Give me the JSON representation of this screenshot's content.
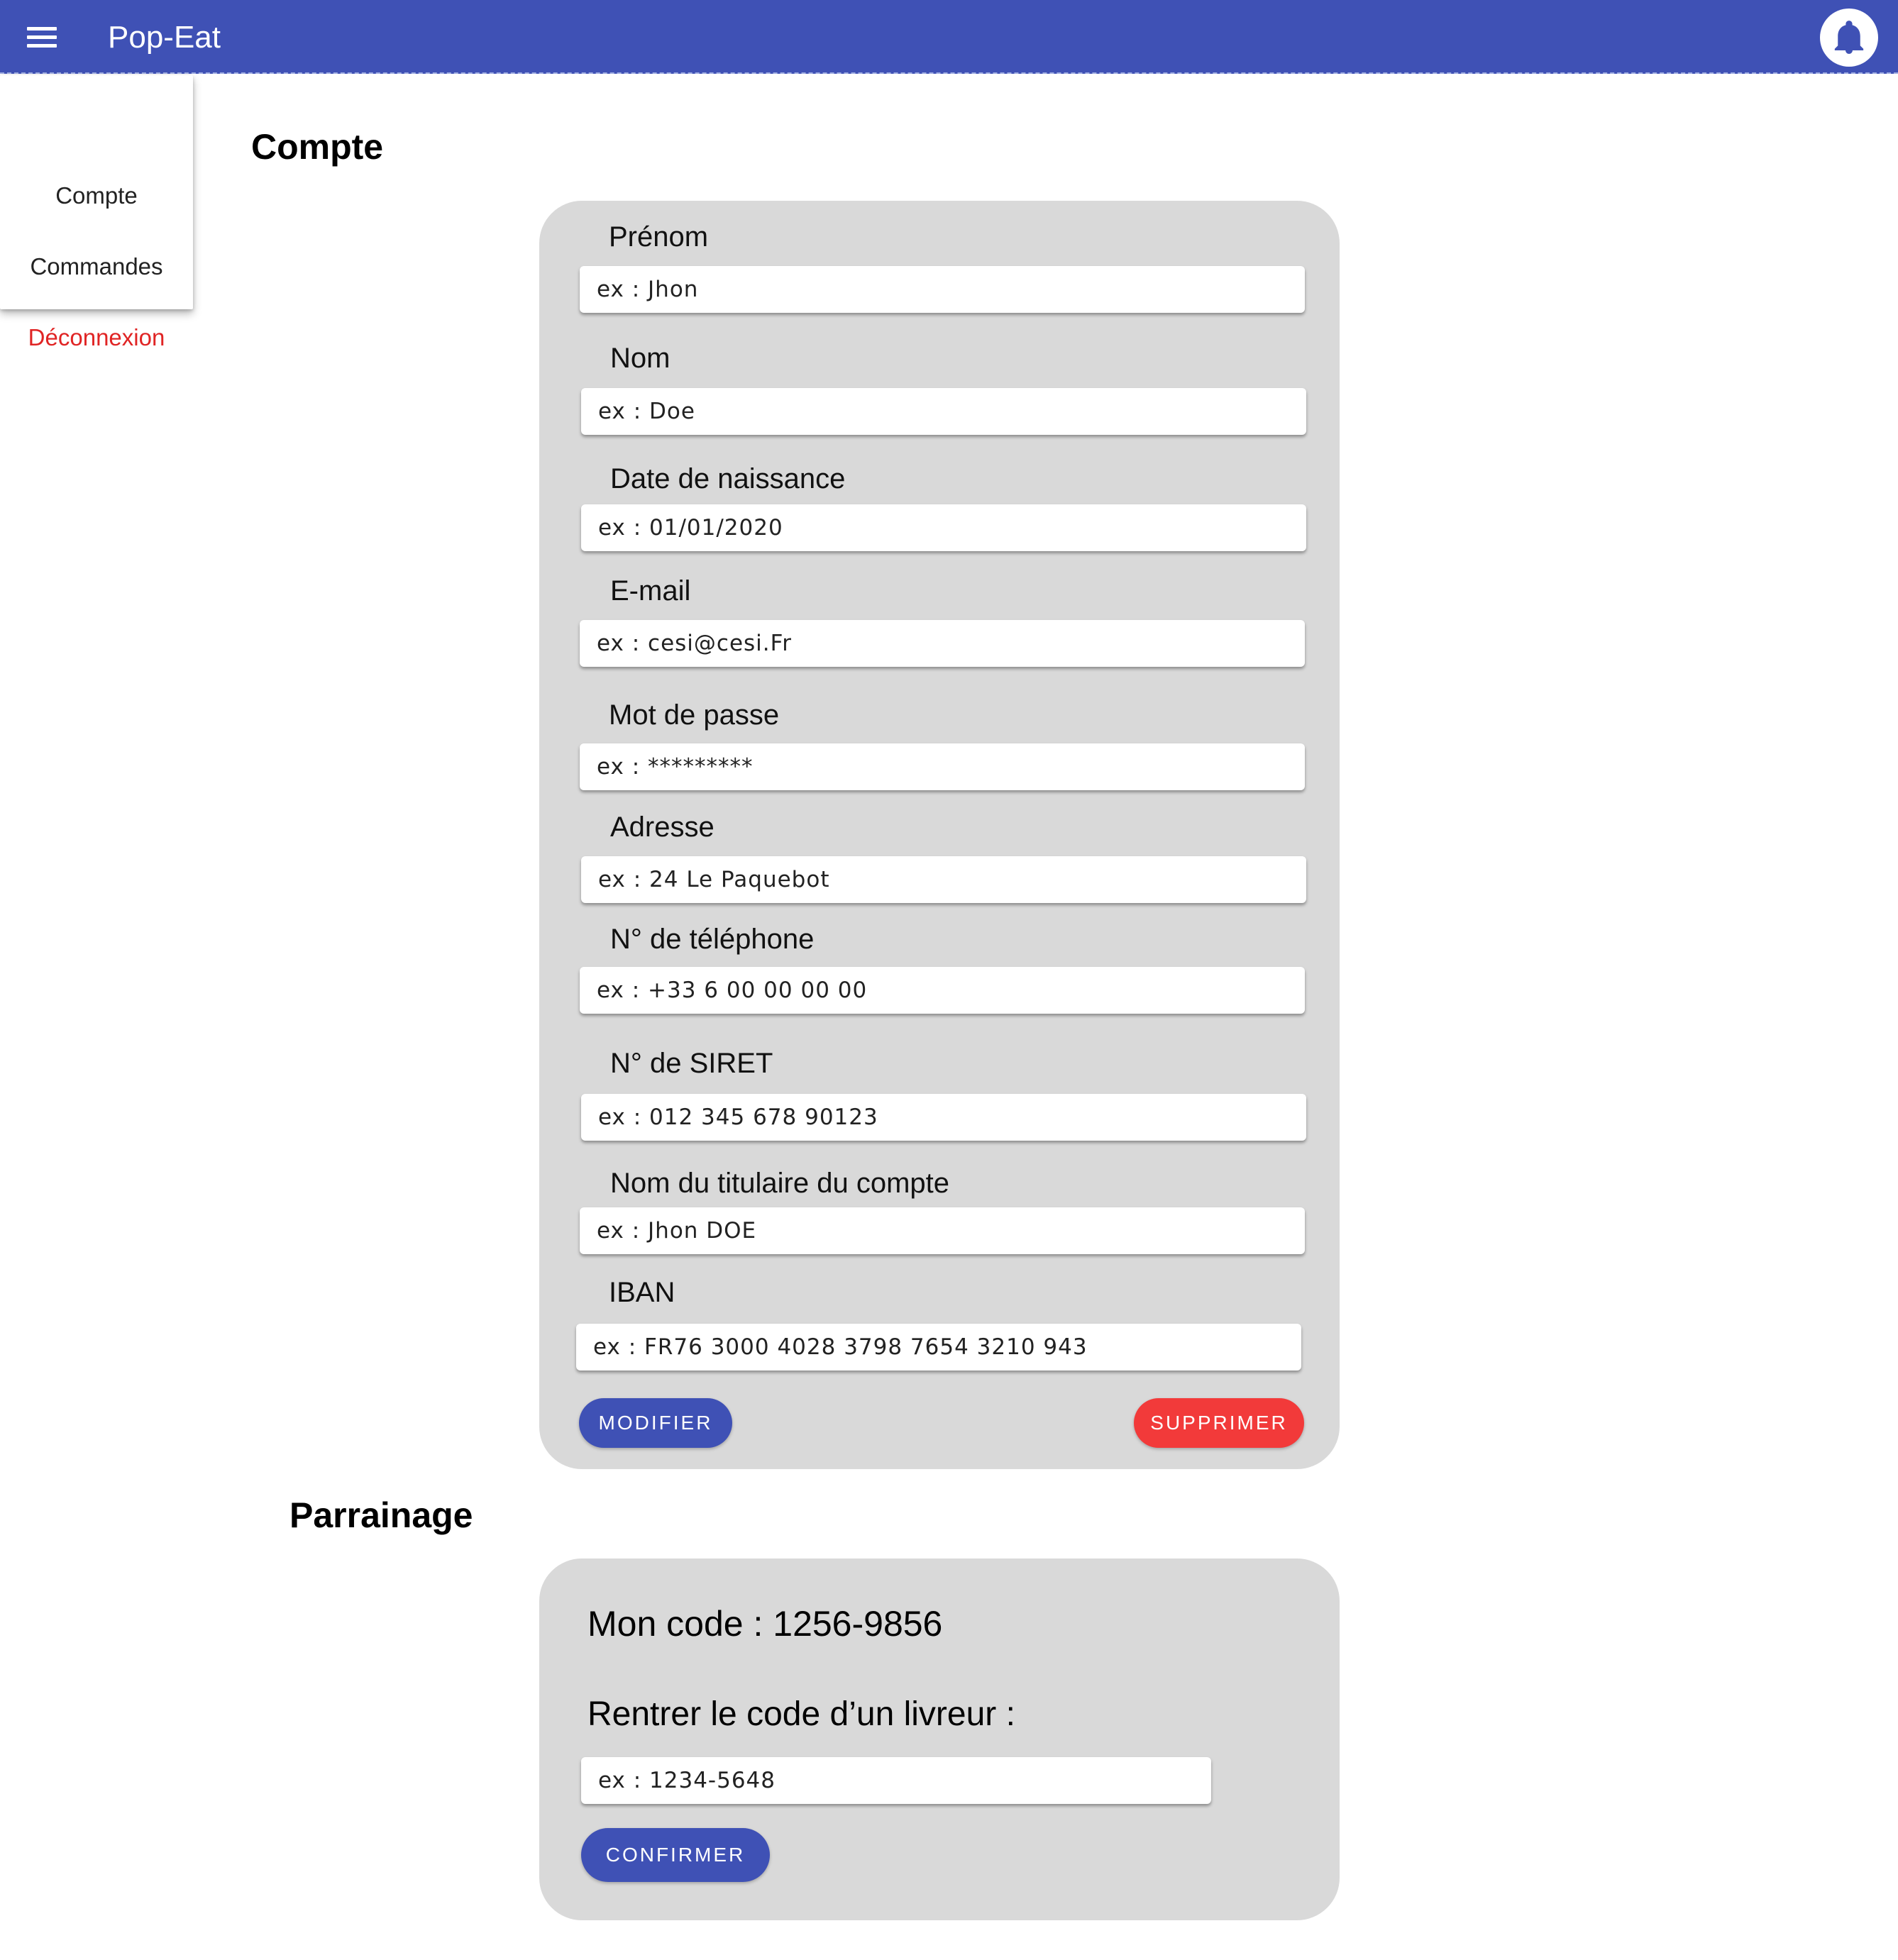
{
  "appbar": {
    "title": "Pop-Eat",
    "menu_icon": "hamburger-menu-icon",
    "notification_icon": "bell-icon",
    "color": "#3f51b5"
  },
  "menu": {
    "items": [
      {
        "label": "Compte"
      },
      {
        "label": "Commandes"
      },
      {
        "label": "Déconnexion"
      }
    ]
  },
  "account": {
    "title": "Compte",
    "fields": {
      "prenom": {
        "label": "Prénom",
        "placeholder": "ex : Jhon"
      },
      "nom": {
        "label": "Nom",
        "placeholder": "ex : Doe"
      },
      "naissance": {
        "label": "Date de naissance",
        "placeholder": "ex : 01/01/2020"
      },
      "email": {
        "label": "E-mail",
        "placeholder": "ex : cesi@cesi.Fr"
      },
      "password": {
        "label": "Mot de passe",
        "placeholder": "ex : *********"
      },
      "adresse": {
        "label": "Adresse",
        "placeholder": "ex : 24 Le Paquebot"
      },
      "telephone": {
        "label": "N° de téléphone",
        "placeholder": "ex : +33 6 00 00 00 00"
      },
      "siret": {
        "label": "N° de SIRET",
        "placeholder": "ex : 012 345 678 90123"
      },
      "titulaire": {
        "label": "Nom du titulaire du compte",
        "placeholder": "ex : Jhon DOE"
      },
      "iban": {
        "label": "IBAN",
        "placeholder": "ex : FR76 3000 4028 3798 7654 3210 943"
      }
    },
    "modify_label": "MODIFIER",
    "delete_label": "SUPPRIMER"
  },
  "referral": {
    "title": "Parrainage",
    "my_code": "Mon code : 1256-9856",
    "enter_code_label": "Rentrer le code d’un livreur :",
    "code_placeholder": "ex : 1234-5648",
    "confirm_label": "CONFIRMER"
  },
  "colors": {
    "primary": "#3f51b5",
    "danger": "#f23a3a",
    "card_bg": "#d9d9d9"
  }
}
